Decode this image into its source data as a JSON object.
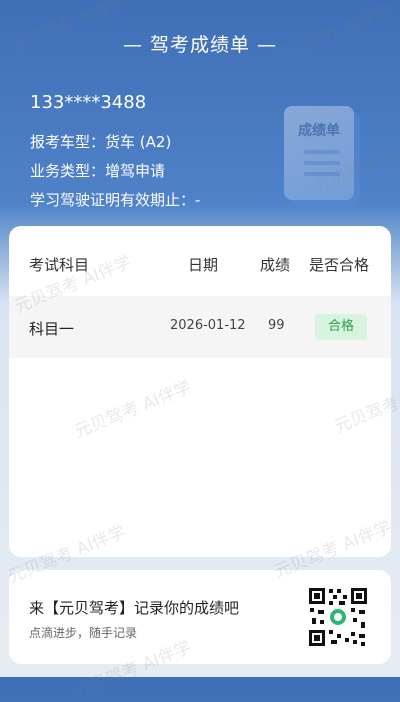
{
  "header": {
    "title": "— 驾考成绩单 —"
  },
  "user": {
    "phone": "133****3488",
    "vehicle_label": "报考车型：",
    "vehicle_value": "货车 (A2)",
    "business_label": "业务类型：",
    "business_value": "增驾申请",
    "validity_label": "学习驾驶证明有效期止：",
    "validity_value": "-"
  },
  "illustration": {
    "label": "成绩单",
    "icon": "report-card-icon"
  },
  "table": {
    "headers": [
      "考试科目",
      "日期",
      "成绩",
      "是否合格"
    ],
    "rows": [
      {
        "subject": "科目一",
        "date": "2026-01-12",
        "score": "99",
        "status": "合格"
      }
    ]
  },
  "footer": {
    "title": "来【元贝驾考】记录你的成绩吧",
    "subtitle": "点滴进步，随手记录",
    "qr_icon": "qr-code-icon"
  },
  "watermark": "元贝驾考 AI伴学",
  "colors": {
    "header_blue": "#3f6fb7",
    "pass_green": "#2ba24c",
    "pass_bg": "#d8f3df"
  }
}
